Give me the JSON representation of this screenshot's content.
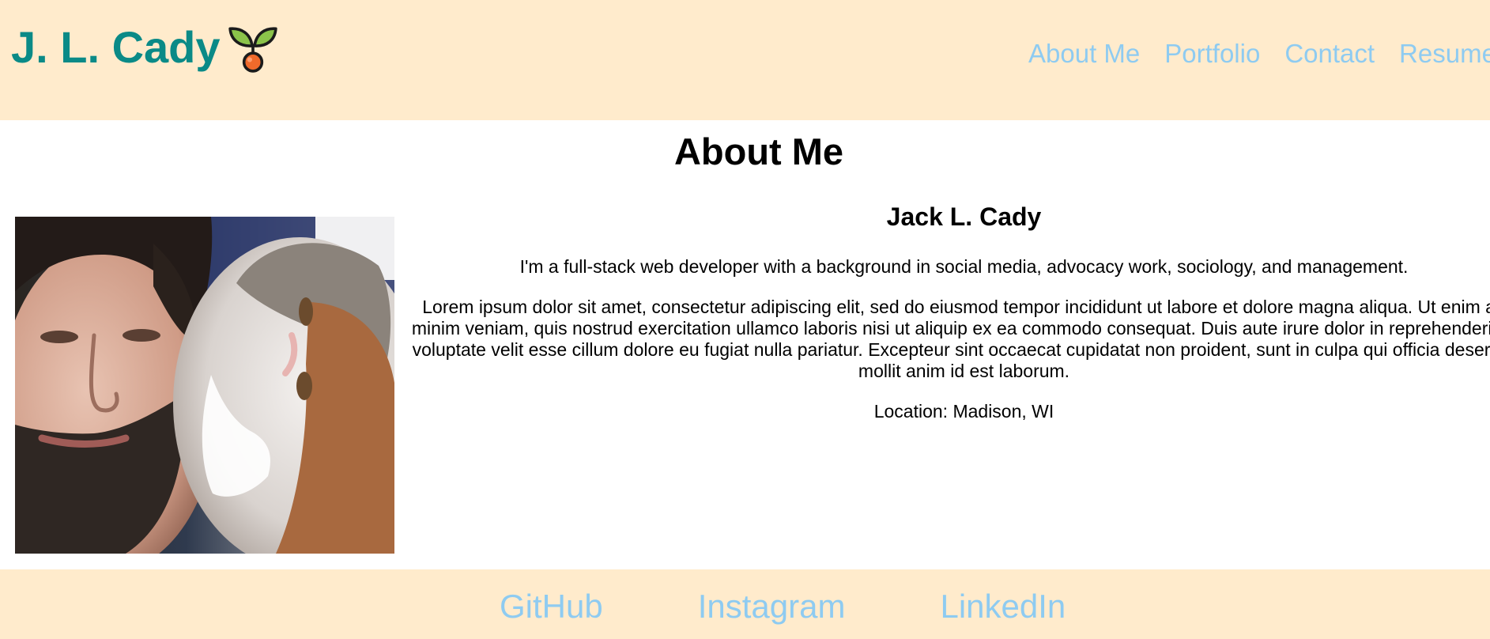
{
  "header": {
    "brand_name": "J. L. Cady",
    "logo_icon": "sprout-icon",
    "nav": [
      {
        "label": "About Me"
      },
      {
        "label": "Portfolio"
      },
      {
        "label": "Contact"
      },
      {
        "label": "Resume"
      }
    ]
  },
  "main": {
    "title": "About Me",
    "photo_icon": "profile-photo",
    "bio": {
      "name": "Jack L. Cady",
      "intro": "I'm a full-stack web developer with a background in social media, advocacy work, sociology, and management.",
      "lorem": "Lorem ipsum dolor sit amet, consectetur adipiscing elit, sed do eiusmod tempor incididunt ut labore et dolore magna aliqua. Ut enim ad minim veniam, quis nostrud exercitation ullamco laboris nisi ut aliquip ex ea commodo consequat. Duis aute irure dolor in reprehenderit in voluptate velit esse cillum dolore eu fugiat nulla pariatur. Excepteur sint occaecat cupidatat non proident, sunt in culpa qui officia deserunt mollit anim id est laborum.",
      "location": "Location: Madison, WI"
    }
  },
  "footer": {
    "links": [
      {
        "label": "GitHub"
      },
      {
        "label": "Instagram"
      },
      {
        "label": "LinkedIn"
      }
    ]
  },
  "colors": {
    "header_bg": "#ffebcc",
    "brand": "#0a8a87",
    "link": "#8ecbf1",
    "text": "#000000",
    "page_bg": "#ffffff"
  }
}
